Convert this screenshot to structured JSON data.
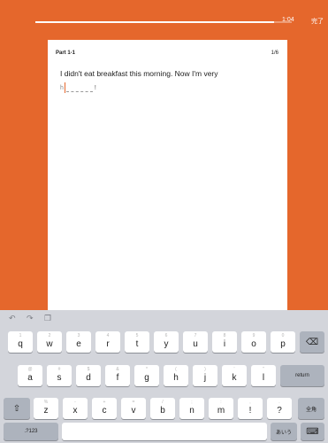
{
  "header": {
    "progress": 0.93,
    "timer": "1:04",
    "finish_label": "完了"
  },
  "question": {
    "part": "Part 1-1",
    "page": "1/6",
    "sentence": "I didn't eat breakfast this morning. Now I'm very",
    "hint": "h",
    "end_punct": "!"
  },
  "keyboard": {
    "undo_icon": "undo-icon",
    "redo_icon": "redo-icon",
    "paste_icon": "paste-icon",
    "row1": [
      {
        "main": "q",
        "sub": "1"
      },
      {
        "main": "w",
        "sub": "2"
      },
      {
        "main": "e",
        "sub": "3"
      },
      {
        "main": "r",
        "sub": "4"
      },
      {
        "main": "t",
        "sub": "5"
      },
      {
        "main": "y",
        "sub": "6"
      },
      {
        "main": "u",
        "sub": "7"
      },
      {
        "main": "i",
        "sub": "8"
      },
      {
        "main": "o",
        "sub": "9"
      },
      {
        "main": "p",
        "sub": "0"
      }
    ],
    "row2": [
      {
        "main": "a",
        "sub": "@"
      },
      {
        "main": "s",
        "sub": "#"
      },
      {
        "main": "d",
        "sub": "$"
      },
      {
        "main": "f",
        "sub": "&"
      },
      {
        "main": "g",
        "sub": "*"
      },
      {
        "main": "h",
        "sub": "("
      },
      {
        "main": "j",
        "sub": ")"
      },
      {
        "main": "k",
        "sub": "'"
      },
      {
        "main": "l",
        "sub": "\""
      }
    ],
    "row3": [
      {
        "main": "z",
        "sub": "%"
      },
      {
        "main": "x",
        "sub": "-"
      },
      {
        "main": "c",
        "sub": "+"
      },
      {
        "main": "v",
        "sub": "="
      },
      {
        "main": "b",
        "sub": "/"
      },
      {
        "main": "n",
        "sub": ";"
      },
      {
        "main": "m",
        "sub": ":"
      },
      {
        "main": "!",
        "sub": ","
      },
      {
        "main": "?",
        "sub": "."
      }
    ],
    "delete_label": "⌫",
    "return_label": "return",
    "shift_label": "⇧",
    "kana_label": "全角",
    "numbers_label": ".?123",
    "space_label": "",
    "ime_label": "あいう",
    "hide_label": "⌨"
  }
}
